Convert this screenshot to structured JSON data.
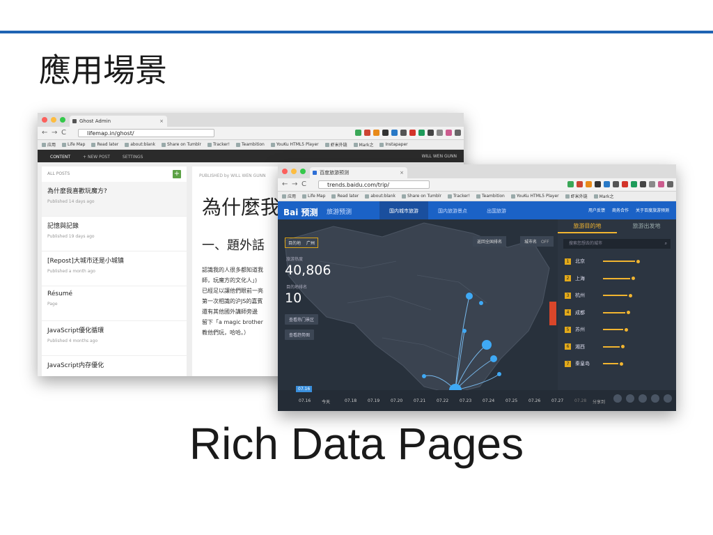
{
  "slide": {
    "title": "應用場景",
    "caption": "Rich Data Pages"
  },
  "colors": {
    "accent_line": "#1f63b3",
    "ghost_nav": "#2b2b2b",
    "baidu_blue": "#1b62c6",
    "map_bg": "#28313c",
    "highlight": "#f2b530"
  },
  "ghost_window": {
    "tab_title": "Ghost Admin",
    "url": "lifemap.in/ghost/",
    "bookmarks": [
      "应用",
      "Life Map",
      "Read later",
      "about:blank",
      "Share on Tumblr",
      "Tracker!",
      "Teambition",
      "YouKu HTML5 Player",
      "虾米外链",
      "Mark之",
      "Instapaper"
    ],
    "nav": {
      "content": "CONTENT",
      "new_post": "+ NEW POST",
      "settings": "SETTINGS",
      "user": "WILL WEN GUNN"
    },
    "all_posts": "ALL POSTS",
    "posts": [
      {
        "title": "為什麼我喜歡玩魔方?",
        "meta": "Published 14 days ago"
      },
      {
        "title": "記憶與記錄",
        "meta": "Published 19 days ago"
      },
      {
        "title": "[Repost]大城市还是小城镇",
        "meta": "Published a month ago"
      },
      {
        "title": "Résumé",
        "meta": "Page"
      },
      {
        "title": "JavaScript優化循環",
        "meta": "Published 4 months ago"
      },
      {
        "title": "JavaScript内存優化",
        "meta": ""
      }
    ],
    "editor": {
      "published_by": "PUBLISHED by WILL WEN GUNN",
      "title": "為什麼我",
      "subtitle": "一、題外話",
      "lines": [
        "認識我的人很多都知道我",
        "師，玩魔方的文化人」)",
        "已經足以讓他們眼前一亮",
        "第一次相識的沪JS的嘉賓",
        "還有其他國外講師旁邊",
        "留下「a magic brother",
        "教他們玩，哈哈。）"
      ]
    }
  },
  "baidu_window": {
    "tab_title": "百度旅游预测",
    "url": "trends.baidu.com/trip/",
    "bookmarks": [
      "应用",
      "Life Map",
      "Read later",
      "about:blank",
      "Share on Tumblr",
      "Tracker!",
      "Teambition",
      "YouKu HTML5 Player",
      "虾米外链",
      "Mark之"
    ],
    "logo": "Bai 预测",
    "section": "旅游预测",
    "tabs": [
      "国内城市旅游",
      "国内旅游景点",
      "出国旅游"
    ],
    "links": [
      "用户反馈",
      "商务合作",
      "关于百度旅游预测"
    ],
    "destination_label": "目的地",
    "destination": "广州",
    "heat_label": "旅游热度",
    "heat_value": "40,806",
    "rank_label": "目的地排名",
    "rank_value": "10",
    "hot_spots_btn": "查看热门景区",
    "trend_btn": "查看趋势图",
    "back_btn": "返回全国排名",
    "city_name_toggle": "城市名",
    "toggle_state": "OFF",
    "side_tabs": [
      "旅游目的地",
      "旅游出发地"
    ],
    "search_placeholder": "搜索您想去的城市",
    "rankings": [
      {
        "rank": "1",
        "city": "北京",
        "level": 1.0
      },
      {
        "rank": "2",
        "city": "上海",
        "level": 0.85
      },
      {
        "rank": "3",
        "city": "杭州",
        "level": 0.75
      },
      {
        "rank": "4",
        "city": "成都",
        "level": 0.7
      },
      {
        "rank": "5",
        "city": "苏州",
        "level": 0.63
      },
      {
        "rank": "6",
        "city": "湘西",
        "level": 0.52
      },
      {
        "rank": "7",
        "city": "秦皇岛",
        "level": 0.48
      }
    ],
    "timeline": {
      "current": "07.16",
      "dates": [
        "07.16",
        "今天",
        "07.18",
        "07.19",
        "07.20",
        "07.21",
        "07.22",
        "07.23",
        "07.24",
        "07.25",
        "07.26",
        "07.27",
        "07.28"
      ],
      "share_label": "分享到"
    }
  }
}
